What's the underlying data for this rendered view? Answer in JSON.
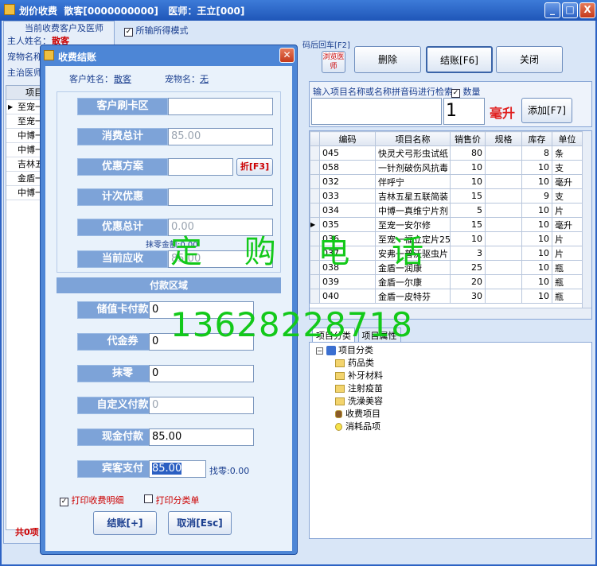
{
  "window": {
    "title": "划价收费  散客[0000000000]   医师：王立[000]",
    "controls": [
      "_",
      "□",
      "X"
    ]
  },
  "left_panel": {
    "header": "当前收费客户及医师",
    "owner_label": "主人姓名：",
    "owner_value": "散客",
    "pet_label": "宠物名称",
    "vet_label": "主治医师",
    "list_header": "项目",
    "list_items": [
      "至宠一",
      "至宠一",
      "中博一",
      "中博一",
      "吉林五",
      "金盾一",
      "中博一"
    ],
    "footer": "共0项"
  },
  "options": {
    "checkbox_label": "所输所得模式",
    "view_vet_label": "浏览医师",
    "hint_trail": "码后回车[F2]"
  },
  "toolbar": {
    "delete": "删除",
    "checkout": "结账[F6]",
    "close": "关闭"
  },
  "search": {
    "hint": "输入项目名称或名称拼音码进行检索",
    "qty_checkbox": "数量",
    "qty_value": "1",
    "unit": "毫升",
    "add_button": "添加[F7]"
  },
  "grid": {
    "headers": [
      "编码",
      "项目名称",
      "销售价",
      "规格",
      "库存",
      "单位"
    ],
    "rows": [
      {
        "code": "045",
        "name": "快灵犬弓形虫试纸",
        "price": "80",
        "spec": "",
        "stock": "8",
        "unit": "条"
      },
      {
        "code": "058",
        "name": "一针剂破伤风抗毒",
        "price": "10",
        "spec": "",
        "stock": "10",
        "unit": "支"
      },
      {
        "code": "032",
        "name": "伴呼宁",
        "price": "10",
        "spec": "",
        "stock": "10",
        "unit": "毫升"
      },
      {
        "code": "033",
        "name": "吉林五星五联简装",
        "price": "15",
        "spec": "",
        "stock": "9",
        "unit": "支"
      },
      {
        "code": "034",
        "name": "中博一真维宁片剂",
        "price": "5",
        "spec": "",
        "stock": "10",
        "unit": "片"
      },
      {
        "code": "035",
        "name": "至宠一安尔修",
        "price": "15",
        "spec": "",
        "stock": "10",
        "unit": "毫升"
      },
      {
        "code": "036",
        "name": "至宠一福立定片25",
        "price": "10",
        "spec": "",
        "stock": "10",
        "unit": "片"
      },
      {
        "code": "037",
        "name": "安弗一普沃驱虫片",
        "price": "3",
        "spec": "",
        "stock": "10",
        "unit": "片"
      },
      {
        "code": "038",
        "name": "金盾一润康",
        "price": "25",
        "spec": "",
        "stock": "10",
        "unit": "瓶"
      },
      {
        "code": "039",
        "name": "金盾一尔康",
        "price": "20",
        "spec": "",
        "stock": "10",
        "unit": "瓶"
      },
      {
        "code": "040",
        "name": "金盾一皮特芬",
        "price": "30",
        "spec": "",
        "stock": "10",
        "unit": "瓶"
      }
    ]
  },
  "tabs": [
    "项目分类",
    "项目属性"
  ],
  "tree": {
    "root": "项目分类",
    "items": [
      "药品类",
      "补牙材料",
      "注射疫苗",
      "洗澡美容",
      "收费项目",
      "消耗品项"
    ]
  },
  "dialog": {
    "title": "收费结账",
    "customer_label": "客户姓名：",
    "customer_value": "散客",
    "pet_label": "宠物名：",
    "pet_value": "无",
    "card_label": "客户刷卡区",
    "total_label": "消费总计",
    "total_value": "85.00",
    "discount_label": "优惠方案",
    "discount_button": "折[F3]",
    "count_discount_label": "计次优惠",
    "discount_total_label": "优惠总计",
    "discount_total_value": "0.00",
    "round_note": "抹零金额:0.00",
    "due_label": "当前应收",
    "due_value": "85.00",
    "payment_section": "付款区域",
    "stored_card_label": "储值卡付款",
    "stored_card_value": "0",
    "voucher_label": "代金券",
    "voucher_value": "0",
    "round_label": "抹零",
    "round_value": "0",
    "custom_label": "自定义付款",
    "custom_value": "0",
    "cash_label": "现金付款",
    "cash_value": "85.00",
    "paid_label": "宾客支付",
    "paid_value": "85.00",
    "change_label": "找零:0.00",
    "print_detail": "打印收费明细",
    "print_category": "打印分类单",
    "ok_button": "结账[+]",
    "cancel_button": "取消[Esc]"
  },
  "watermark": {
    "line1": "定 购 电 话",
    "line2": "13628228718"
  }
}
